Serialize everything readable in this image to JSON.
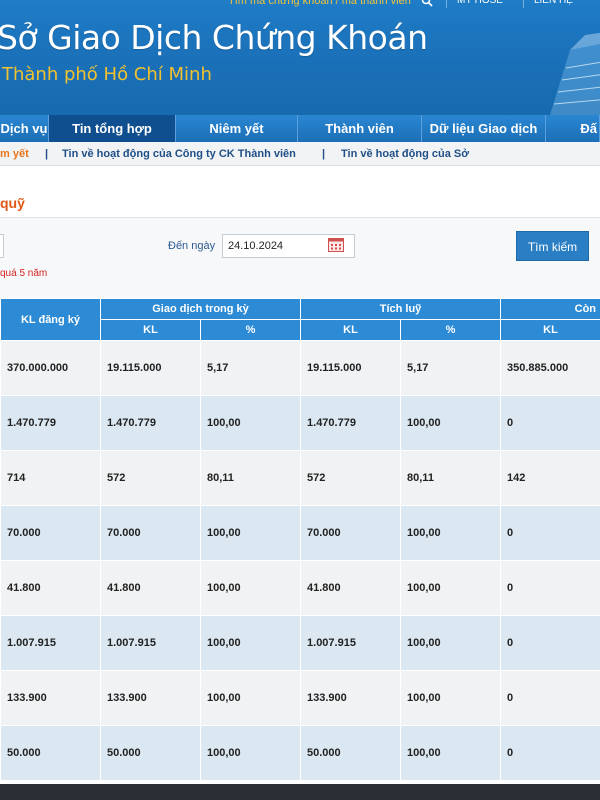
{
  "header": {
    "search_placeholder": "Tìm mã chứng khoán / mã thành viên",
    "links": [
      "MY HOSE",
      "LIÊN HỆ"
    ],
    "title": "Sở Giao Dịch Chứng Khoán",
    "subtitle": "Thành phố Hồ Chí Minh"
  },
  "nav": [
    {
      "label": "Dịch vụ"
    },
    {
      "label": "Tin tổng hợp"
    },
    {
      "label": "Niêm yết"
    },
    {
      "label": "Thành viên"
    },
    {
      "label": "Dữ liệu Giao dịch"
    },
    {
      "label": "Đấ"
    }
  ],
  "subnav": {
    "active": "m yết",
    "link1": "Tin về hoạt động của Công ty CK Thành viên",
    "link2": "Tin về hoạt động của Sở",
    "sep": "|"
  },
  "section_title": "quỹ",
  "filter": {
    "to_date_label": "Đến ngày",
    "to_date_value": "24.10.2024",
    "search_label": "Tìm kiếm",
    "note": "quá 5 năm"
  },
  "table": {
    "head": {
      "reg": "KL đăng ký",
      "group1": "Giao dịch trong kỳ",
      "group2": "Tích luỹ",
      "group3": "Còn",
      "kl": "KL",
      "pct": "%"
    },
    "rows": [
      [
        "370.000.000",
        "19.115.000",
        "5,17",
        "19.115.000",
        "5,17",
        "350.885.000"
      ],
      [
        "1.470.779",
        "1.470.779",
        "100,00",
        "1.470.779",
        "100,00",
        "0"
      ],
      [
        "714",
        "572",
        "80,11",
        "572",
        "80,11",
        "142"
      ],
      [
        "70.000",
        "70.000",
        "100,00",
        "70.000",
        "100,00",
        "0"
      ],
      [
        "41.800",
        "41.800",
        "100,00",
        "41.800",
        "100,00",
        "0"
      ],
      [
        "1.007.915",
        "1.007.915",
        "100,00",
        "1.007.915",
        "100,00",
        "0"
      ],
      [
        "133.900",
        "133.900",
        "100,00",
        "133.900",
        "100,00",
        "0"
      ],
      [
        "50.000",
        "50.000",
        "100,00",
        "50.000",
        "100,00",
        "0"
      ]
    ]
  }
}
